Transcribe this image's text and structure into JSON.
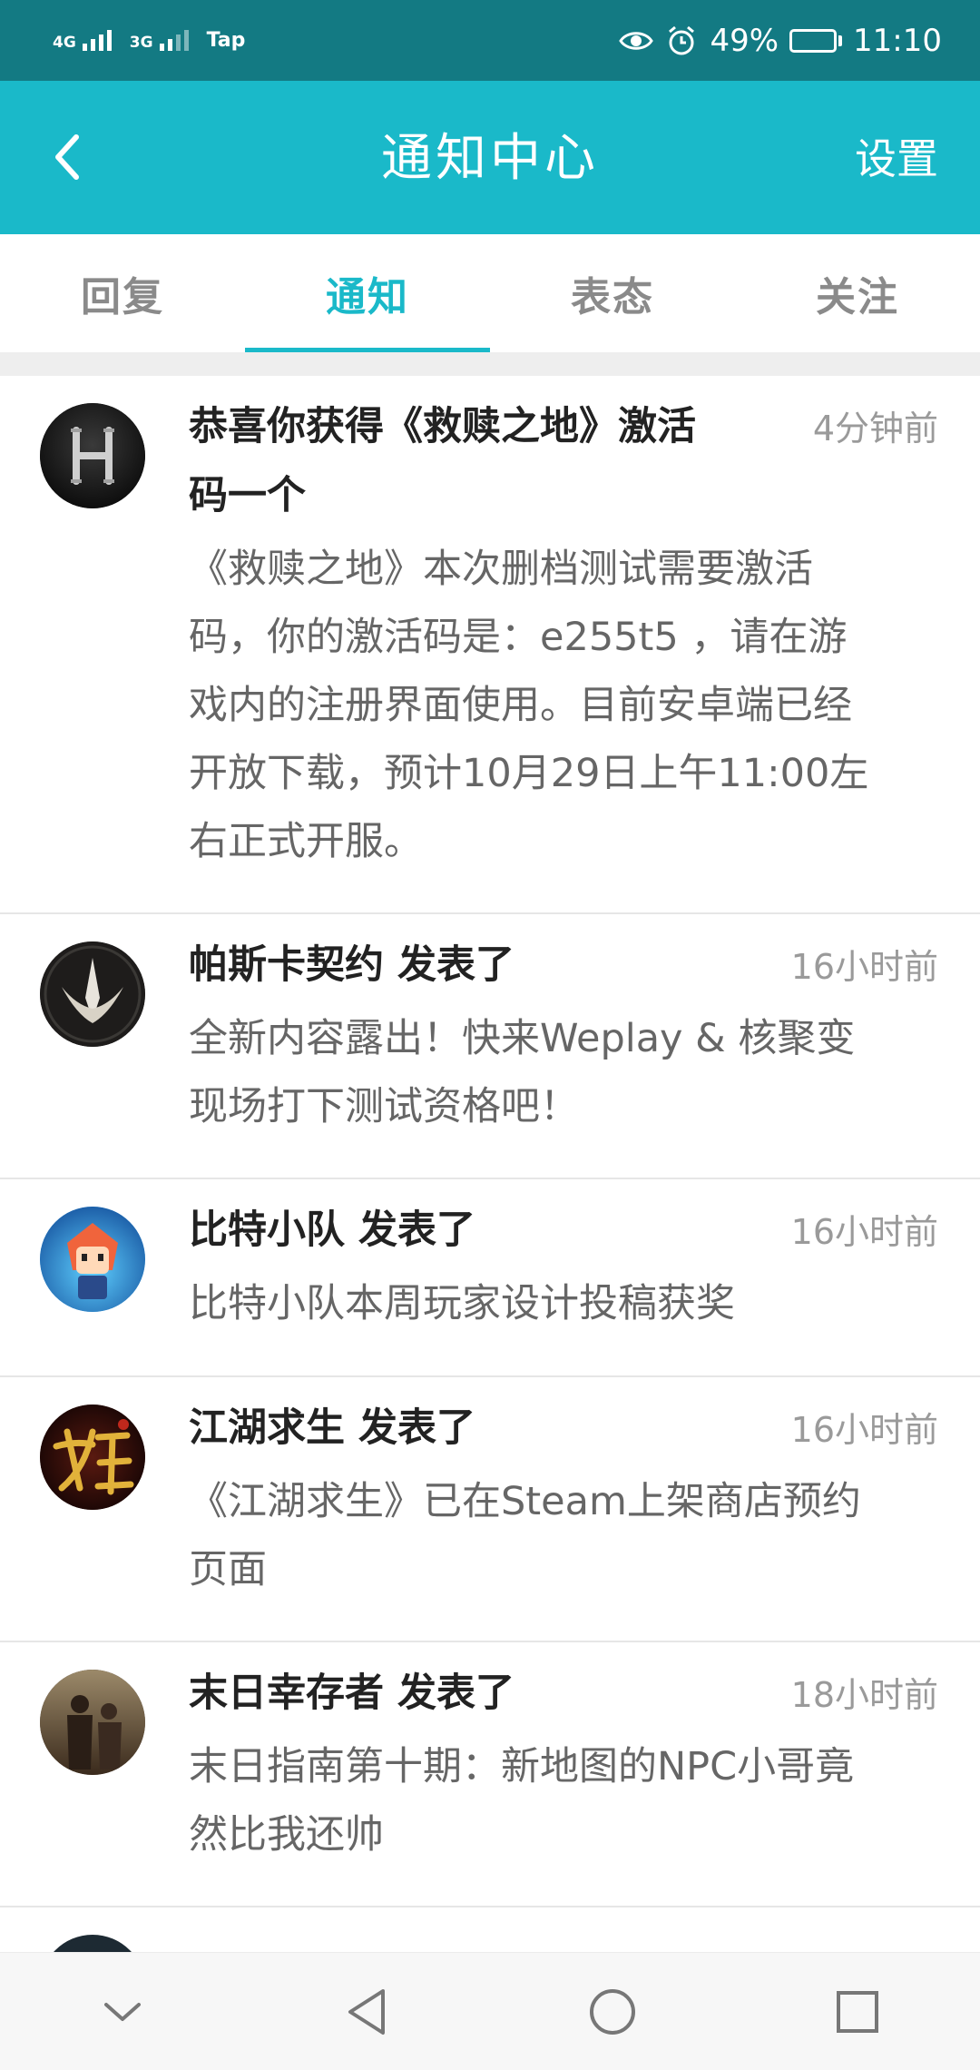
{
  "status_bar": {
    "network_1": "4G",
    "network_2": "3G",
    "carrier_app": "Tap",
    "battery": "49%",
    "battery_level": 0.49,
    "time": "11:10"
  },
  "header": {
    "back_icon": "chevron-left-icon",
    "title": "通知中心",
    "settings_label": "设置"
  },
  "tabs": [
    {
      "label": "回复",
      "active": false
    },
    {
      "label": "通知",
      "active": true
    },
    {
      "label": "表态",
      "active": false
    },
    {
      "label": "关注",
      "active": false
    }
  ],
  "notifications": [
    {
      "title_line1": "恭喜你获得《救赎之地》激活",
      "title_line2": "码一个",
      "time": "4分钟前",
      "body": [
        "《救赎之地》本次删档测试需要激活",
        "码，你的激活码是：e255t5 ，请在游",
        "戏内的注册界面使用。目前安卓端已经",
        "开放下载，预计10月29日上午11:00左",
        "右正式开服。"
      ]
    },
    {
      "title_line1": "帕斯卡契约 发表了",
      "time": "16小时前",
      "body": [
        "全新内容露出！快来Weplay & 核聚变",
        "现场打下测试资格吧！"
      ]
    },
    {
      "title_line1": "比特小队 发表了",
      "time": "16小时前",
      "body": [
        "比特小队本周玩家设计投稿获奖"
      ]
    },
    {
      "title_line1": "江湖求生 发表了",
      "time": "16小时前",
      "body": [
        "《江湖求生》已在Steam上架商店预约",
        "页面"
      ]
    },
    {
      "title_line1": "末日幸存者 发表了",
      "time": "18小时前",
      "body": [
        "末日指南第十期：新地图的NPC小哥竟",
        "然比我还帅"
      ]
    }
  ],
  "nav": {
    "hide_icon": "chevron-down-icon",
    "back_icon": "triangle-back-icon",
    "home_icon": "circle-home-icon",
    "recents_icon": "square-recents-icon"
  },
  "colors": {
    "status_bar": "#137a83",
    "header": "#1ab9c9",
    "accent": "#1ab9c9"
  }
}
